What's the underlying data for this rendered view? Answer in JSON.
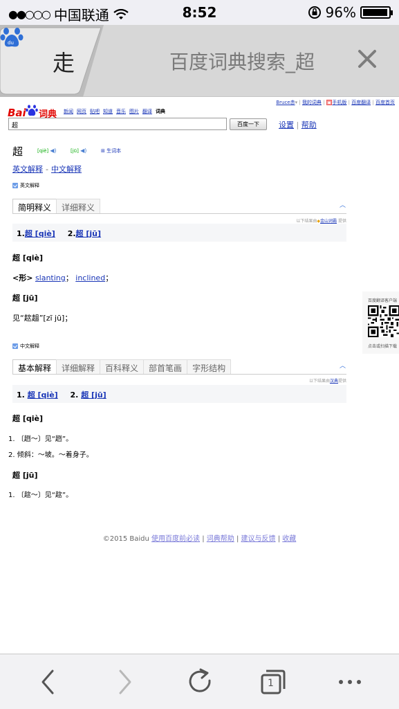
{
  "status": {
    "carrier": "中国联通",
    "time": "8:52",
    "battery": "96%",
    "signal_dots": "●●○○○",
    "battery_level": 0.96
  },
  "tabs": {
    "active_title": "走",
    "inactive_title": "百度词典搜索_超"
  },
  "page": {
    "toplinks": {
      "user": "Bruce赤",
      "my_dict": "我的词典",
      "mobile": "手机版",
      "translate": "百度翻译",
      "home": "百度首页"
    },
    "logo": {
      "bai": "Bai",
      "cidian": "词典"
    },
    "nav": [
      "新闻",
      "网页",
      "贴吧",
      "知道",
      "音乐",
      "图片",
      "翻译",
      "词典"
    ],
    "search": {
      "value": "超",
      "button": "百度一下",
      "settings": "设置",
      "help": "帮助",
      "sep": "|"
    },
    "word": "超",
    "pron1": "[qiè]",
    "pron2": "[jū]",
    "vocab": "生词本",
    "sect_en": "英文解释",
    "sect_cn": "中文解释",
    "sect_sep": "-",
    "en_head": "英文解释",
    "en_tabs": [
      "简明释义",
      "详细释义"
    ],
    "en_source": {
      "prefix": "以下结果由",
      "link": "金山词霸",
      "suffix": "提供"
    },
    "en_summary": [
      {
        "num": "1.",
        "text": "超 [qiè]"
      },
      {
        "num": "2.",
        "text": "超 [jū]"
      }
    ],
    "en_entry1": "超 [qiè]",
    "en_pos": "<形>",
    "en_def1": "slanting",
    "en_def_sep": "；",
    "en_def2": "inclined",
    "en_def_end": "；",
    "en_entry2": "超 [jū]",
    "en_def3": "见“趑趄”[zī jū]；",
    "cn_head": "中文解释",
    "cn_tabs": [
      "基本解释",
      "详细解释",
      "百科释义",
      "部首笔画",
      "字形结构"
    ],
    "cn_source": {
      "prefix": "以下结果由",
      "link": "汉典",
      "suffix": "提供"
    },
    "cn_summary": [
      {
        "num": "1.",
        "text": "超 [qiè]"
      },
      {
        "num": "2.",
        "text": "超 [jū]"
      }
    ],
    "cn_entry1": "超 [qiè]",
    "cn_def1": "1. 〔趔～〕见“趔”。",
    "cn_def2": "2. 倾斜：～坡。～着身子。",
    "cn_entry2": "超 [jū]",
    "cn_def3": "1. 〔趑～〕见“趑”。",
    "qr": {
      "title": "百度翻译客户端",
      "caption": "点击或扫描下载"
    },
    "footer": {
      "copyright": "©2015 Baidu",
      "l1": "使用百度前必读",
      "l2": "词典帮助",
      "l3": "建议与反馈",
      "l4": "收藏",
      "sep": "|"
    }
  },
  "toolbar": {
    "tab_count": "1"
  },
  "colors": {
    "accent": "#1a36b7",
    "baidu_red": "#e10602",
    "baidu_blue": "#2932e1"
  }
}
